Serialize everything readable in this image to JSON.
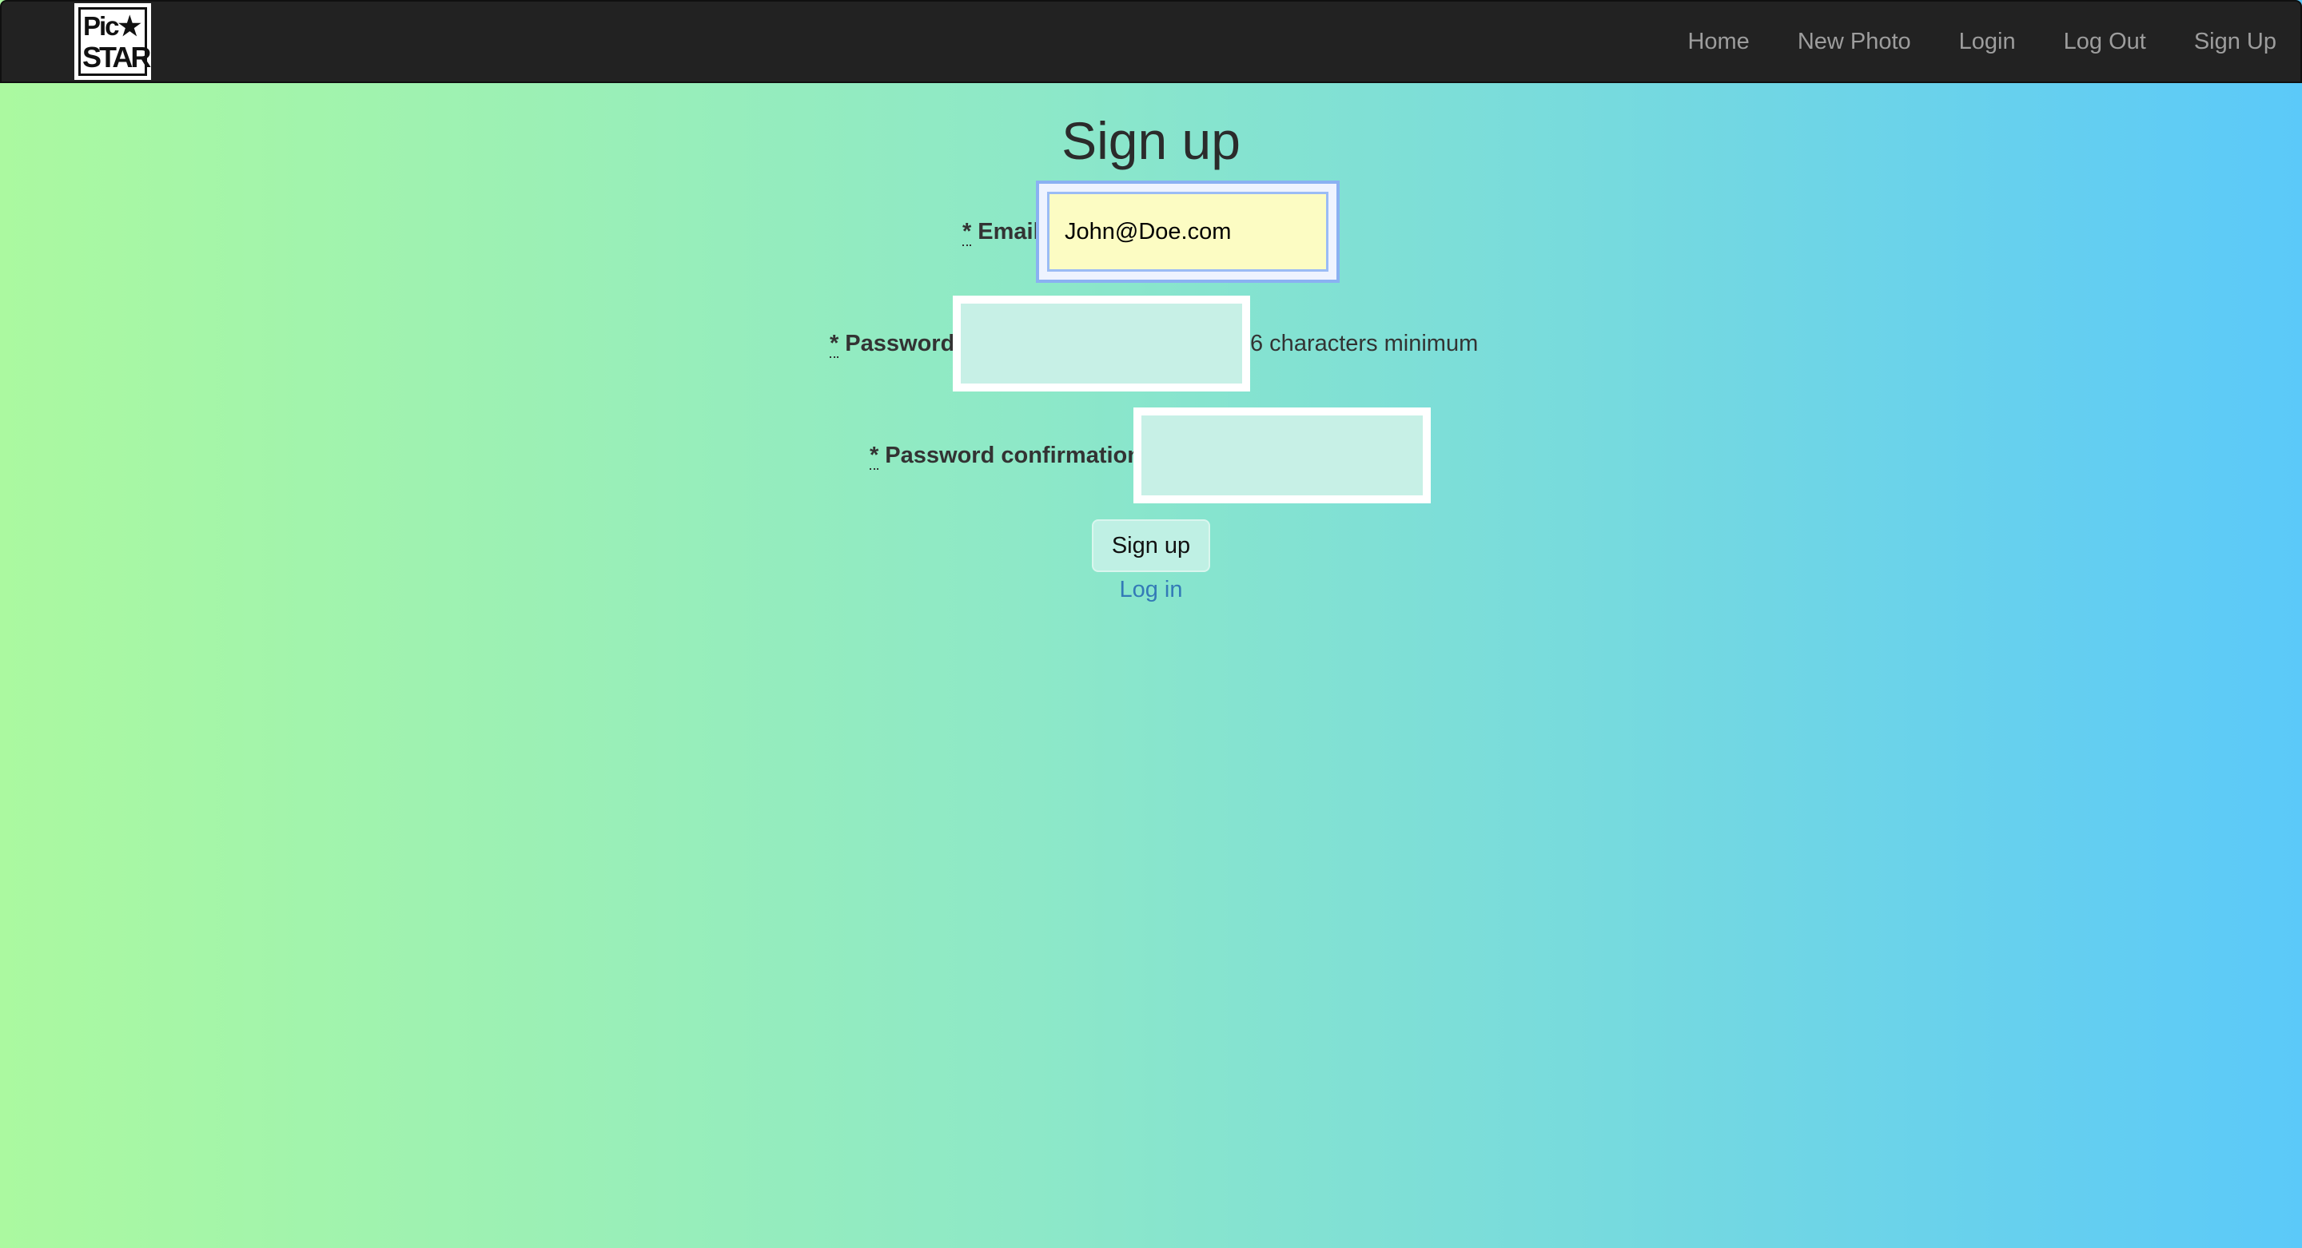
{
  "navbar": {
    "logo": {
      "line1": "Pic★",
      "line2": "STAR"
    },
    "links": [
      "Home",
      "New Photo",
      "Login",
      "Log Out",
      "Sign Up"
    ]
  },
  "page": {
    "title": "Sign up"
  },
  "form": {
    "required_marker": "*",
    "email": {
      "label": "Email",
      "value": "John@Doe.com"
    },
    "password": {
      "label": "Password",
      "value": "",
      "hint": "6 characters minimum"
    },
    "password_confirmation": {
      "label": "Password confirmation",
      "value": ""
    },
    "submit_label": "Sign up",
    "login_link": "Log in"
  },
  "colors": {
    "navbar_bg": "#222222",
    "nav_link": "#9d9d9d",
    "gradient_left": "#abf9a0",
    "gradient_right": "#5bc9f9",
    "link": "#337ab7",
    "focused_input_bg": "#fcfcc3"
  }
}
